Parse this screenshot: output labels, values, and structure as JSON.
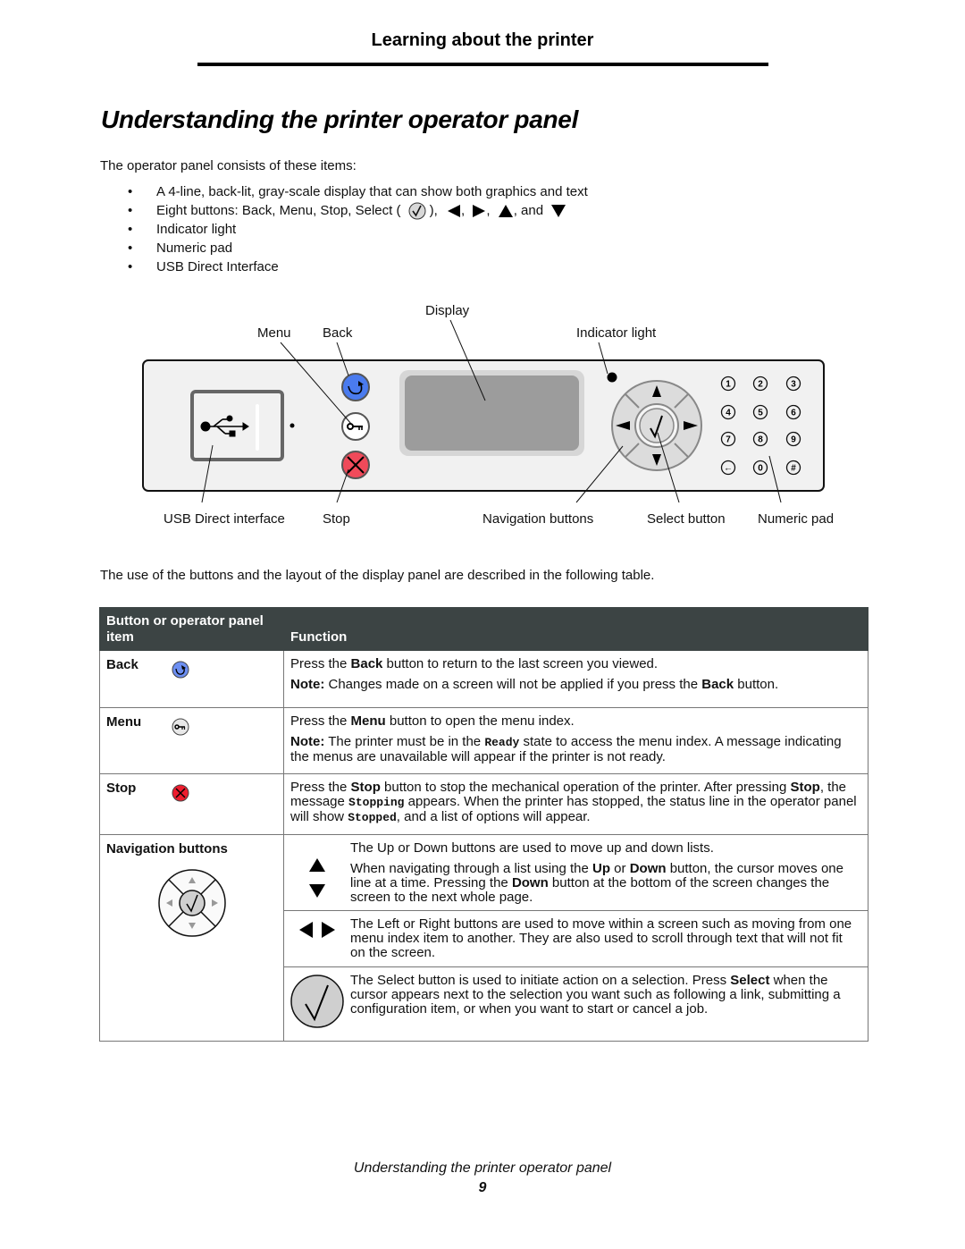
{
  "header": {
    "section_title": "Learning about the printer"
  },
  "page_title": "Understanding the printer operator panel",
  "intro": "The operator panel consists of these items:",
  "bullets": {
    "item1": "A 4-line, back-lit, gray-scale display that can show both graphics and text",
    "item2_prefix": "Eight buttons: Back, Menu, Stop, Select (",
    "item2_after_select": "),",
    "item2_sep1": ",",
    "item2_sep2": ",",
    "item2_sep3": ", and",
    "item3": "Indicator light",
    "item4": "Numeric pad",
    "item5": "USB Direct Interface",
    "bullet_char": "•"
  },
  "diagram": {
    "labels": {
      "display": "Display",
      "menu": "Menu",
      "back": "Back",
      "indicator_light": "Indicator light",
      "usb": "USB Direct interface",
      "stop": "Stop",
      "navigation": "Navigation buttons",
      "select": "Select button",
      "numeric_pad": "Numeric pad"
    },
    "keypad": [
      "1",
      "2",
      "3",
      "4",
      "5",
      "6",
      "7",
      "8",
      "9",
      "←",
      "0",
      "#"
    ],
    "colors": {
      "back": "#4a7bef",
      "stop": "#f04a5a",
      "panel": "#f1f1f1",
      "display": "#9c9c9c"
    }
  },
  "table_intro": "The use of the buttons and the layout of the display panel are described in the following table.",
  "table": {
    "headers": {
      "item": "Button or operator panel item",
      "function": "Function"
    },
    "rows": {
      "back": {
        "name": "Back",
        "f1_a": "Press the ",
        "f1_b": "Back",
        "f1_c": " button to return to the last screen you viewed.",
        "note_label": "Note:",
        "note_a": " Changes made on a screen will not be applied if you press the ",
        "note_b": "Back",
        "note_c": " button."
      },
      "menu": {
        "name": "Menu",
        "f1_a": "Press the ",
        "f1_b": "Menu",
        "f1_c": " button to open the menu index.",
        "note_label": "Note:",
        "note_a": " The printer must be in the ",
        "note_code": "Ready",
        "note_c": " state to access the menu index. A message indicating the menus are unavailable will appear if the printer is not ready."
      },
      "stop": {
        "name": "Stop",
        "f_a": "Press the ",
        "f_b": "Stop",
        "f_c": " button to stop the mechanical operation of the printer. After pressing ",
        "f_d": "Stop",
        "f_e": ", the message ",
        "f_code1": "Stopping",
        "f_f": " appears. When the printer has stopped, the status line in the operator panel will show ",
        "f_code2": "Stopped",
        "f_g": ", and a list of options will appear."
      },
      "navigation": {
        "name": "Navigation buttons",
        "updown_1": "The Up or Down buttons are used to move up and down lists.",
        "updown_2a": "When navigating through a list using the ",
        "updown_2b": "Up",
        "updown_2c": " or ",
        "updown_2d": "Down",
        "updown_2e": " button, the cursor moves one line at a time. Pressing the ",
        "updown_2f": "Down",
        "updown_2g": " button at the bottom of the screen changes the screen to the next whole page.",
        "leftright": "The Left or Right buttons are used to move within a screen such as moving from one menu index item to another. They are also used to scroll through text that will not fit on the screen.",
        "select_a": "The Select button is used to initiate action on a selection. Press ",
        "select_b": "Select",
        "select_c": " when the cursor appears next to the selection you want such as following a link, submitting a configuration item, or when you want to start or cancel a job."
      }
    }
  },
  "footer": {
    "title": "Understanding the printer operator panel",
    "page_number": "9"
  }
}
